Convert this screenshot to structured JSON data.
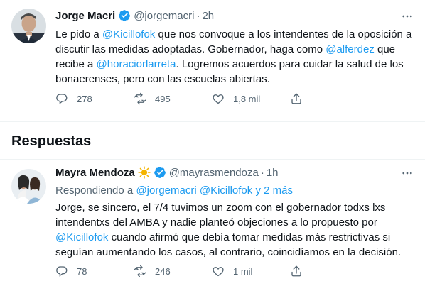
{
  "main_tweet": {
    "author_name": "Jorge Macri",
    "handle": "@jorgemacri",
    "separator": "·",
    "time": "2h",
    "text_parts": [
      {
        "t": "Le pido a ",
        "m": false
      },
      {
        "t": "@Kicillofok",
        "m": true
      },
      {
        "t": " que nos convoque a los intendentes de la oposición a discutir las medidas adoptadas. Gobernador, haga como ",
        "m": false
      },
      {
        "t": "@alferdez",
        "m": true
      },
      {
        "t": " que recibe a ",
        "m": false
      },
      {
        "t": "@horaciorlarreta",
        "m": true
      },
      {
        "t": ". Logremos acuerdos para cuidar la salud de los bonaerenses, pero con las escuelas abiertas.",
        "m": false
      }
    ],
    "replies": "278",
    "retweets": "495",
    "likes": "1,8 mil",
    "share": ""
  },
  "section": {
    "responses_title": "Respuestas"
  },
  "reply_tweet": {
    "author_name": "Mayra Mendoza",
    "handle": "@mayrasmendoza",
    "separator": "·",
    "time": "1h",
    "replying_prefix": "Respondiendo a ",
    "replying_to_1": "@jorgemacri",
    "replying_to_2": "@Kicillofok",
    "replying_more": "y 2 más",
    "text_parts": [
      {
        "t": "Jorge, se sincero, el 7/4 tuvimos un zoom con el gobernador todxs lxs intendentxs del AMBA y nadie planteó objeciones a lo propuesto por ",
        "m": false
      },
      {
        "t": "@Kicillofok",
        "m": true
      },
      {
        "t": " cuando afirmó que debía tomar medidas más restrictivas si seguían aumentando los casos, al contrario, coincidíamos en la decisión.",
        "m": false
      }
    ],
    "replies": "78",
    "retweets": "246",
    "likes": "1 mil",
    "share": ""
  },
  "colors": {
    "accent": "#1d9bf0",
    "muted": "#536471",
    "text": "#0f1419",
    "divider": "#eff3f4"
  },
  "icons": {
    "reply": "reply-icon",
    "retweet": "retweet-icon",
    "like": "heart-icon",
    "share": "share-icon",
    "verified": "verified-badge-icon",
    "more": "more-icon",
    "sun": "sun-emoji-icon"
  }
}
